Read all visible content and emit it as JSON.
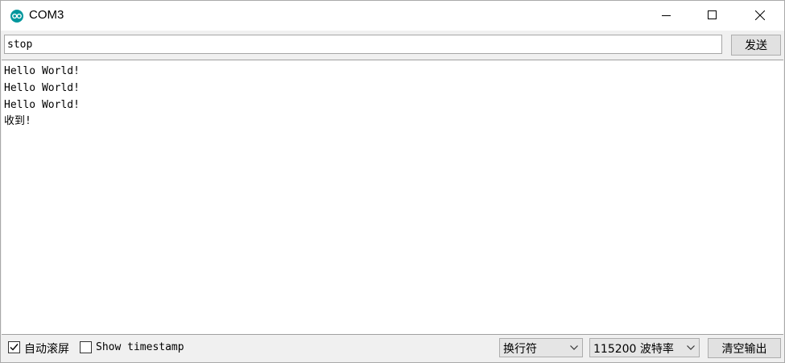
{
  "window": {
    "title": "COM3"
  },
  "send_bar": {
    "input_value": "stop",
    "send_label": "发送"
  },
  "output": {
    "lines": [
      "Hello World!",
      "Hello World!",
      "Hello World!",
      "收到!"
    ]
  },
  "footer": {
    "autoscroll_label": "自动滚屏",
    "autoscroll_checked": true,
    "timestamp_label": "Show timestamp",
    "timestamp_checked": false,
    "line_ending_value": "换行符",
    "baud_rate_value": "115200 波特率",
    "clear_label": "清空输出"
  },
  "colors": {
    "app_icon": "#00979d"
  }
}
